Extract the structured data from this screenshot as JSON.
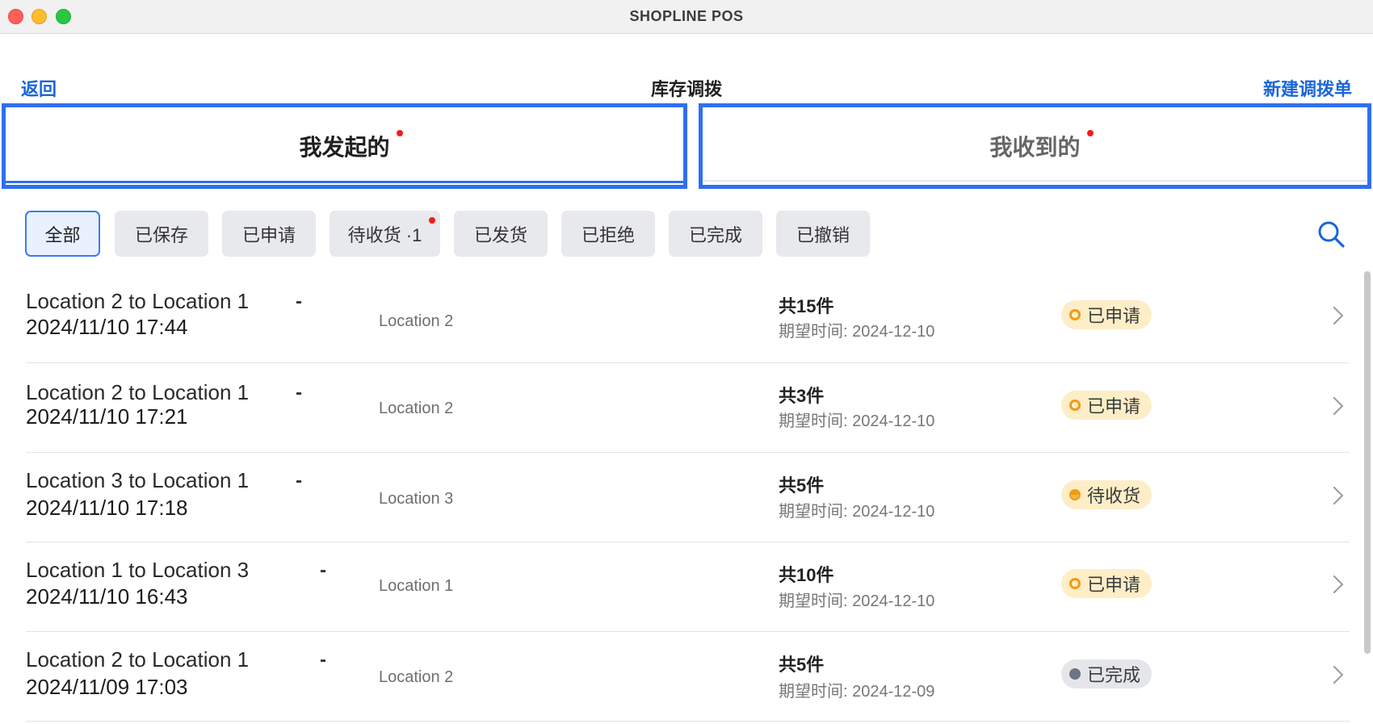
{
  "window": {
    "title": "SHOPLINE POS"
  },
  "nav": {
    "back": "返回",
    "title": "库存调拨",
    "new": "新建调拨单"
  },
  "tabs": [
    {
      "label": "我发起的",
      "selected": true,
      "dot": true
    },
    {
      "label": "我收到的",
      "selected": false,
      "dot": true
    }
  ],
  "filters": [
    {
      "label": "全部",
      "active": true
    },
    {
      "label": "已保存"
    },
    {
      "label": "已申请"
    },
    {
      "label": "待收货 ·1",
      "dot": true
    },
    {
      "label": "已发货"
    },
    {
      "label": "已拒绝"
    },
    {
      "label": "已完成"
    },
    {
      "label": "已撤销"
    }
  ],
  "search_icon": "search-icon",
  "transfers": [
    {
      "title": "Location 2 to Location 1",
      "date": "2024/11/10 17:44",
      "dash": "-",
      "location": "Location 2",
      "count": "共15件",
      "expect": "期望时间: 2024-12-10",
      "status": "已申请",
      "status_type": "applied"
    },
    {
      "title": "Location 2 to Location 1",
      "date": "2024/11/10 17:21",
      "dash": "-",
      "location": "Location 2",
      "count": "共3件",
      "expect": "期望时间: 2024-12-10",
      "status": "已申请",
      "status_type": "applied"
    },
    {
      "title": "Location 3 to Location 1",
      "date": "2024/11/10 17:18",
      "dash": "-",
      "location": "Location 3",
      "count": "共5件",
      "expect": "期望时间: 2024-12-10",
      "status": "待收货",
      "status_type": "pending"
    },
    {
      "title": "Location 1 to Location 3",
      "date": "2024/11/10 16:43",
      "dash": "-",
      "location": "Location 1",
      "count": "共10件",
      "expect": "期望时间: 2024-12-10",
      "status": "已申请",
      "status_type": "applied"
    },
    {
      "title": "Location 2 to Location 1",
      "date": "2024/11/09 17:03",
      "dash": "-",
      "location": "Location 2",
      "count": "共5件",
      "expect": "期望时间: 2024-12-09",
      "status": "已完成",
      "status_type": "done"
    }
  ],
  "colors": {
    "accent": "#1a66d9",
    "tab_border": "#2f6ff0",
    "red_dot": "#f21c1c",
    "badge_yellow": "#fdeec8",
    "badge_grey": "#e4e6ea"
  }
}
